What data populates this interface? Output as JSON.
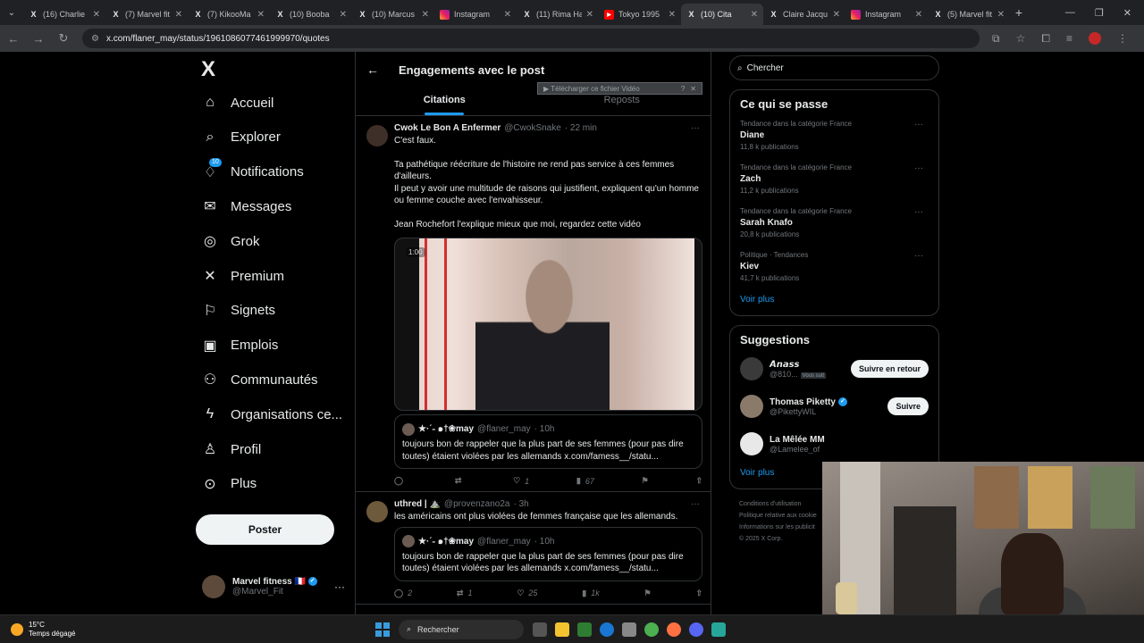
{
  "browser": {
    "tabs": [
      {
        "label": "(16) Charlie",
        "icon": "x-logo"
      },
      {
        "label": "(7) Marvel fit",
        "icon": "x-logo"
      },
      {
        "label": "(7) KikooMa",
        "icon": "x-logo"
      },
      {
        "label": "(10) Booba",
        "icon": "x-logo"
      },
      {
        "label": "(10) Marcus",
        "icon": "x-logo"
      },
      {
        "label": "Instagram",
        "icon": "instagram-logo"
      },
      {
        "label": "(11) Rima Ha",
        "icon": "x-logo"
      },
      {
        "label": "Tokyo 1995",
        "icon": "youtube-logo"
      },
      {
        "label": "(10) Cita",
        "icon": "x-logo",
        "active": true
      },
      {
        "label": "Claire Jacqu",
        "icon": "x-logo"
      },
      {
        "label": "Instagram",
        "icon": "instagram-logo"
      },
      {
        "label": "(5) Marvel fit",
        "icon": "x-logo"
      }
    ],
    "url": "x.com/flaner_may/status/1961086077461999970/quotes"
  },
  "nav": {
    "logo": "X",
    "items": [
      {
        "label": "Accueil",
        "icon": "home-icon"
      },
      {
        "label": "Explorer",
        "icon": "search-icon"
      },
      {
        "label": "Notifications",
        "icon": "bell-icon",
        "badge": "10"
      },
      {
        "label": "Messages",
        "icon": "envelope-icon"
      },
      {
        "label": "Grok",
        "icon": "grok-icon"
      },
      {
        "label": "Premium",
        "icon": "x-icon"
      },
      {
        "label": "Signets",
        "icon": "bookmark-icon"
      },
      {
        "label": "Emplois",
        "icon": "briefcase-icon"
      },
      {
        "label": "Communautés",
        "icon": "people-icon"
      },
      {
        "label": "Organisations ce...",
        "icon": "lightning-icon"
      },
      {
        "label": "Profil",
        "icon": "person-icon"
      },
      {
        "label": "Plus",
        "icon": "more-circle-icon"
      }
    ],
    "post_button": "Poster",
    "account": {
      "name": "Marvel fitness 🇫🇷",
      "handle": "@Marvel_Fit"
    }
  },
  "main": {
    "title": "Engagements avec le post",
    "tabs": [
      "Citations",
      "Reposts"
    ],
    "active_tab": "Citations",
    "download_bar": "▶ Télécharger ce fichier Vidéo",
    "posts": [
      {
        "name": "Cwok Le Bon A Enfermer",
        "handle": "@CwokSnake",
        "time": "· 22 min",
        "paragraphs": [
          "C'est faux.",
          "Ta pathétique réécriture de l'histoire ne rend pas service à ces femmes d'ailleurs.\nIl peut y avoir une multitude de raisons qui justifient, expliquent qu'un homme ou femme couche avec l'envahisseur.",
          "Jean Rochefort l'explique mieux que moi, regardez cette vidéo"
        ],
        "video_duration": "1:00",
        "quote": {
          "name": "★·ˊ˗ ๑†❀may",
          "handle": "@flaner_may",
          "time": "· 10h",
          "text": "toujours bon de rappeler que la plus part de ses femmes (pour pas dire toutes) étaient violées par les allemands x.com/famess__/statu..."
        },
        "stats": {
          "replies": "",
          "reposts": "",
          "likes": "1",
          "views": "67"
        }
      },
      {
        "name": "uthred | ⛰️",
        "handle": "@provenzano2a",
        "time": "· 3h",
        "paragraphs": [
          "les américains ont plus violées de femmes française que les allemands."
        ],
        "quote": {
          "name": "★·ˊ˗ ๑†❀may",
          "handle": "@flaner_may",
          "time": "· 10h",
          "text": "toujours bon de rappeler que la plus part de ses femmes (pour pas dire toutes) étaient violées par les allemands x.com/famess__/statu..."
        },
        "stats": {
          "replies": "2",
          "reposts": "1",
          "likes": "25",
          "views": "1k"
        }
      }
    ]
  },
  "sidebar": {
    "search_placeholder": "Chercher",
    "trends_title": "Ce qui se passe",
    "trends": [
      {
        "context": "Tendance dans la catégorie France",
        "name": "Diane",
        "count": "11,8 k publications"
      },
      {
        "context": "Tendance dans la catégorie France",
        "name": "Zach",
        "count": "11,2 k publications"
      },
      {
        "context": "Tendance dans la catégorie France",
        "name": "Sarah Knafo",
        "count": "20,8 k publications"
      },
      {
        "context": "Politique · Tendances",
        "name": "Kiev",
        "count": "41,7 k publications"
      }
    ],
    "trends_more": "Voir plus",
    "suggestions_title": "Suggestions",
    "suggestions": [
      {
        "name": "𝘼𝙣𝙖𝙨𝙨",
        "handle": "@810...",
        "tag": "Vous suit",
        "button": "Suivre en retour",
        "avatar_color": "#3a3a3a"
      },
      {
        "name": "Thomas Piketty",
        "handle": "@PikettyWIL",
        "tag": "",
        "button": "Suivre",
        "avatar_color": "#8a7a6a",
        "verified": true
      },
      {
        "name": "La Mêlée MM",
        "handle": "@Lamelee_of",
        "tag": "",
        "button": "",
        "avatar_color": "#e8e8e8"
      }
    ],
    "suggestions_more": "Voir plus",
    "footer": [
      "Conditions d'utilisation",
      "Politique relative aux cookie",
      "Informations sur les publicit",
      "© 2025 X Corp."
    ]
  },
  "taskbar": {
    "weather_temp": "15°C",
    "weather_desc": "Temps dégagé",
    "search": "Rechercher"
  }
}
